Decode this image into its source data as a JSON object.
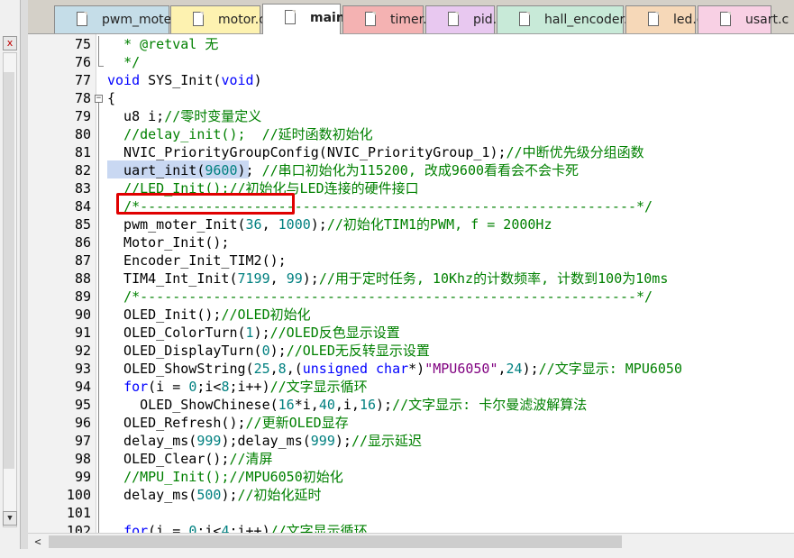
{
  "tabs": [
    {
      "label": "pwm_moter.c",
      "color": "#c5dde8",
      "active": false
    },
    {
      "label": "motor.c",
      "color": "#fdf2b0",
      "active": false
    },
    {
      "label": "main.c",
      "color": "#ffffff",
      "active": true
    },
    {
      "label": "timer.c",
      "color": "#f4b2b2",
      "active": false
    },
    {
      "label": "pid.c",
      "color": "#e8c8f0",
      "active": false
    },
    {
      "label": "hall_encoder.c",
      "color": "#c8ead8",
      "active": false
    },
    {
      "label": "led.c",
      "color": "#f6d8b8",
      "active": false
    },
    {
      "label": "usart.c",
      "color": "#f8d0e4",
      "active": false
    }
  ],
  "left_panel": {
    "close_glyph": "x",
    "scroll_down_glyph": "▼"
  },
  "editor": {
    "lines": [
      {
        "num": "75",
        "parts": [
          {
            "t": "  ",
            "c": ""
          },
          {
            "t": "* @retval 无",
            "c": "cm"
          }
        ]
      },
      {
        "num": "76",
        "parts": [
          {
            "t": "  ",
            "c": ""
          },
          {
            "t": "*/",
            "c": "cm"
          }
        ]
      },
      {
        "num": "77",
        "parts": [
          {
            "t": "void",
            "c": "kw"
          },
          {
            "t": " SYS_Init(",
            "c": ""
          },
          {
            "t": "void",
            "c": "kw"
          },
          {
            "t": ")",
            "c": ""
          }
        ]
      },
      {
        "num": "78",
        "parts": [
          {
            "t": "{",
            "c": ""
          }
        ]
      },
      {
        "num": "79",
        "parts": [
          {
            "t": "  u8 i;",
            "c": ""
          },
          {
            "t": "//零时变量定义",
            "c": "cm"
          }
        ]
      },
      {
        "num": "80",
        "parts": [
          {
            "t": "  ",
            "c": ""
          },
          {
            "t": "//delay_init();  //延时函数初始化",
            "c": "cm"
          }
        ]
      },
      {
        "num": "81",
        "parts": [
          {
            "t": "  NVIC_PriorityGroupConfig(NVIC_PriorityGroup_1);",
            "c": ""
          },
          {
            "t": "//中断优先级分组函数",
            "c": "cm"
          }
        ]
      },
      {
        "num": "82",
        "parts": [
          {
            "t": "  uart_init(",
            "c": ""
          },
          {
            "t": "9600",
            "c": "nm"
          },
          {
            "t": "); ",
            "c": ""
          },
          {
            "t": "//串口初始化为115200, 改成9600看看会不会卡死",
            "c": "cm"
          }
        ]
      },
      {
        "num": "83",
        "parts": [
          {
            "t": "  ",
            "c": ""
          },
          {
            "t": "//LED_Init();//初始化与LED连接的硬件接口",
            "c": "cm"
          }
        ]
      },
      {
        "num": "84",
        "parts": [
          {
            "t": "  ",
            "c": ""
          },
          {
            "t": "/*-------------------------------------------------------------*/",
            "c": "cm"
          }
        ]
      },
      {
        "num": "85",
        "parts": [
          {
            "t": "  pwm_moter_Init(",
            "c": ""
          },
          {
            "t": "36",
            "c": "nm"
          },
          {
            "t": ", ",
            "c": ""
          },
          {
            "t": "1000",
            "c": "nm"
          },
          {
            "t": ");",
            "c": ""
          },
          {
            "t": "//初始化TIM1的PWM, f = 2000Hz",
            "c": "cm"
          }
        ]
      },
      {
        "num": "86",
        "parts": [
          {
            "t": "  Motor_Init();",
            "c": ""
          }
        ]
      },
      {
        "num": "87",
        "parts": [
          {
            "t": "  Encoder_Init_TIM2();",
            "c": ""
          }
        ]
      },
      {
        "num": "88",
        "parts": [
          {
            "t": "  TIM4_Int_Init(",
            "c": ""
          },
          {
            "t": "7199",
            "c": "nm"
          },
          {
            "t": ", ",
            "c": ""
          },
          {
            "t": "99",
            "c": "nm"
          },
          {
            "t": ");",
            "c": ""
          },
          {
            "t": "//用于定时任务, 10Khz的计数频率, 计数到100为10ms",
            "c": "cm"
          }
        ]
      },
      {
        "num": "89",
        "parts": [
          {
            "t": "  ",
            "c": ""
          },
          {
            "t": "/*-------------------------------------------------------------*/",
            "c": "cm"
          }
        ]
      },
      {
        "num": "90",
        "parts": [
          {
            "t": "  OLED_Init();",
            "c": ""
          },
          {
            "t": "//OLED初始化",
            "c": "cm"
          }
        ]
      },
      {
        "num": "91",
        "parts": [
          {
            "t": "  OLED_ColorTurn(",
            "c": ""
          },
          {
            "t": "1",
            "c": "nm"
          },
          {
            "t": ");",
            "c": ""
          },
          {
            "t": "//OLED反色显示设置",
            "c": "cm"
          }
        ]
      },
      {
        "num": "92",
        "parts": [
          {
            "t": "  OLED_DisplayTurn(",
            "c": ""
          },
          {
            "t": "0",
            "c": "nm"
          },
          {
            "t": ");",
            "c": ""
          },
          {
            "t": "//OLED无反转显示设置",
            "c": "cm"
          }
        ]
      },
      {
        "num": "93",
        "parts": [
          {
            "t": "  OLED_ShowString(",
            "c": ""
          },
          {
            "t": "25",
            "c": "nm"
          },
          {
            "t": ",",
            "c": ""
          },
          {
            "t": "8",
            "c": "nm"
          },
          {
            "t": ",(",
            "c": ""
          },
          {
            "t": "unsigned char",
            "c": "kw"
          },
          {
            "t": "*)",
            "c": ""
          },
          {
            "t": "\"MPU6050\"",
            "c": "st"
          },
          {
            "t": ",",
            "c": ""
          },
          {
            "t": "24",
            "c": "nm"
          },
          {
            "t": ");",
            "c": ""
          },
          {
            "t": "//文字显示: MPU6050",
            "c": "cm"
          }
        ]
      },
      {
        "num": "94",
        "parts": [
          {
            "t": "  ",
            "c": ""
          },
          {
            "t": "for",
            "c": "kw"
          },
          {
            "t": "(i = ",
            "c": ""
          },
          {
            "t": "0",
            "c": "nm"
          },
          {
            "t": ";i<",
            "c": ""
          },
          {
            "t": "8",
            "c": "nm"
          },
          {
            "t": ";i++)",
            "c": ""
          },
          {
            "t": "//文字显示循环",
            "c": "cm"
          }
        ]
      },
      {
        "num": "95",
        "parts": [
          {
            "t": "    OLED_ShowChinese(",
            "c": ""
          },
          {
            "t": "16",
            "c": "nm"
          },
          {
            "t": "*i,",
            "c": ""
          },
          {
            "t": "40",
            "c": "nm"
          },
          {
            "t": ",i,",
            "c": ""
          },
          {
            "t": "16",
            "c": "nm"
          },
          {
            "t": ");",
            "c": ""
          },
          {
            "t": "//文字显示: 卡尔曼滤波解算法",
            "c": "cm"
          }
        ]
      },
      {
        "num": "96",
        "parts": [
          {
            "t": "  OLED_Refresh();",
            "c": ""
          },
          {
            "t": "//更新OLED显存",
            "c": "cm"
          }
        ]
      },
      {
        "num": "97",
        "parts": [
          {
            "t": "  delay_ms(",
            "c": ""
          },
          {
            "t": "999",
            "c": "nm"
          },
          {
            "t": ");delay_ms(",
            "c": ""
          },
          {
            "t": "999",
            "c": "nm"
          },
          {
            "t": ");",
            "c": ""
          },
          {
            "t": "//显示延迟",
            "c": "cm"
          }
        ]
      },
      {
        "num": "98",
        "parts": [
          {
            "t": "  OLED_Clear();",
            "c": ""
          },
          {
            "t": "//清屏",
            "c": "cm"
          }
        ]
      },
      {
        "num": "99",
        "parts": [
          {
            "t": "  ",
            "c": ""
          },
          {
            "t": "//MPU_Init();//MPU6050初始化",
            "c": "cm"
          }
        ]
      },
      {
        "num": "100",
        "parts": [
          {
            "t": "  delay_ms(",
            "c": ""
          },
          {
            "t": "500",
            "c": "nm"
          },
          {
            "t": ");",
            "c": ""
          },
          {
            "t": "//初始化延时",
            "c": "cm"
          }
        ]
      },
      {
        "num": "101",
        "parts": []
      },
      {
        "num": "102",
        "parts": [
          {
            "t": "  ",
            "c": ""
          },
          {
            "t": "for",
            "c": "kw"
          },
          {
            "t": "(i = ",
            "c": ""
          },
          {
            "t": "0",
            "c": "nm"
          },
          {
            "t": ";i<",
            "c": ""
          },
          {
            "t": "4",
            "c": "nm"
          },
          {
            "t": ";i++)",
            "c": ""
          },
          {
            "t": "//文字显示循环",
            "c": "cm"
          }
        ]
      }
    ]
  },
  "hscroll": {
    "left_glyph": "<"
  },
  "colors": {
    "comment": "#008000",
    "keyword": "#0000ff",
    "number": "#008080",
    "string": "#800080",
    "highlight_box": "#e00000"
  }
}
